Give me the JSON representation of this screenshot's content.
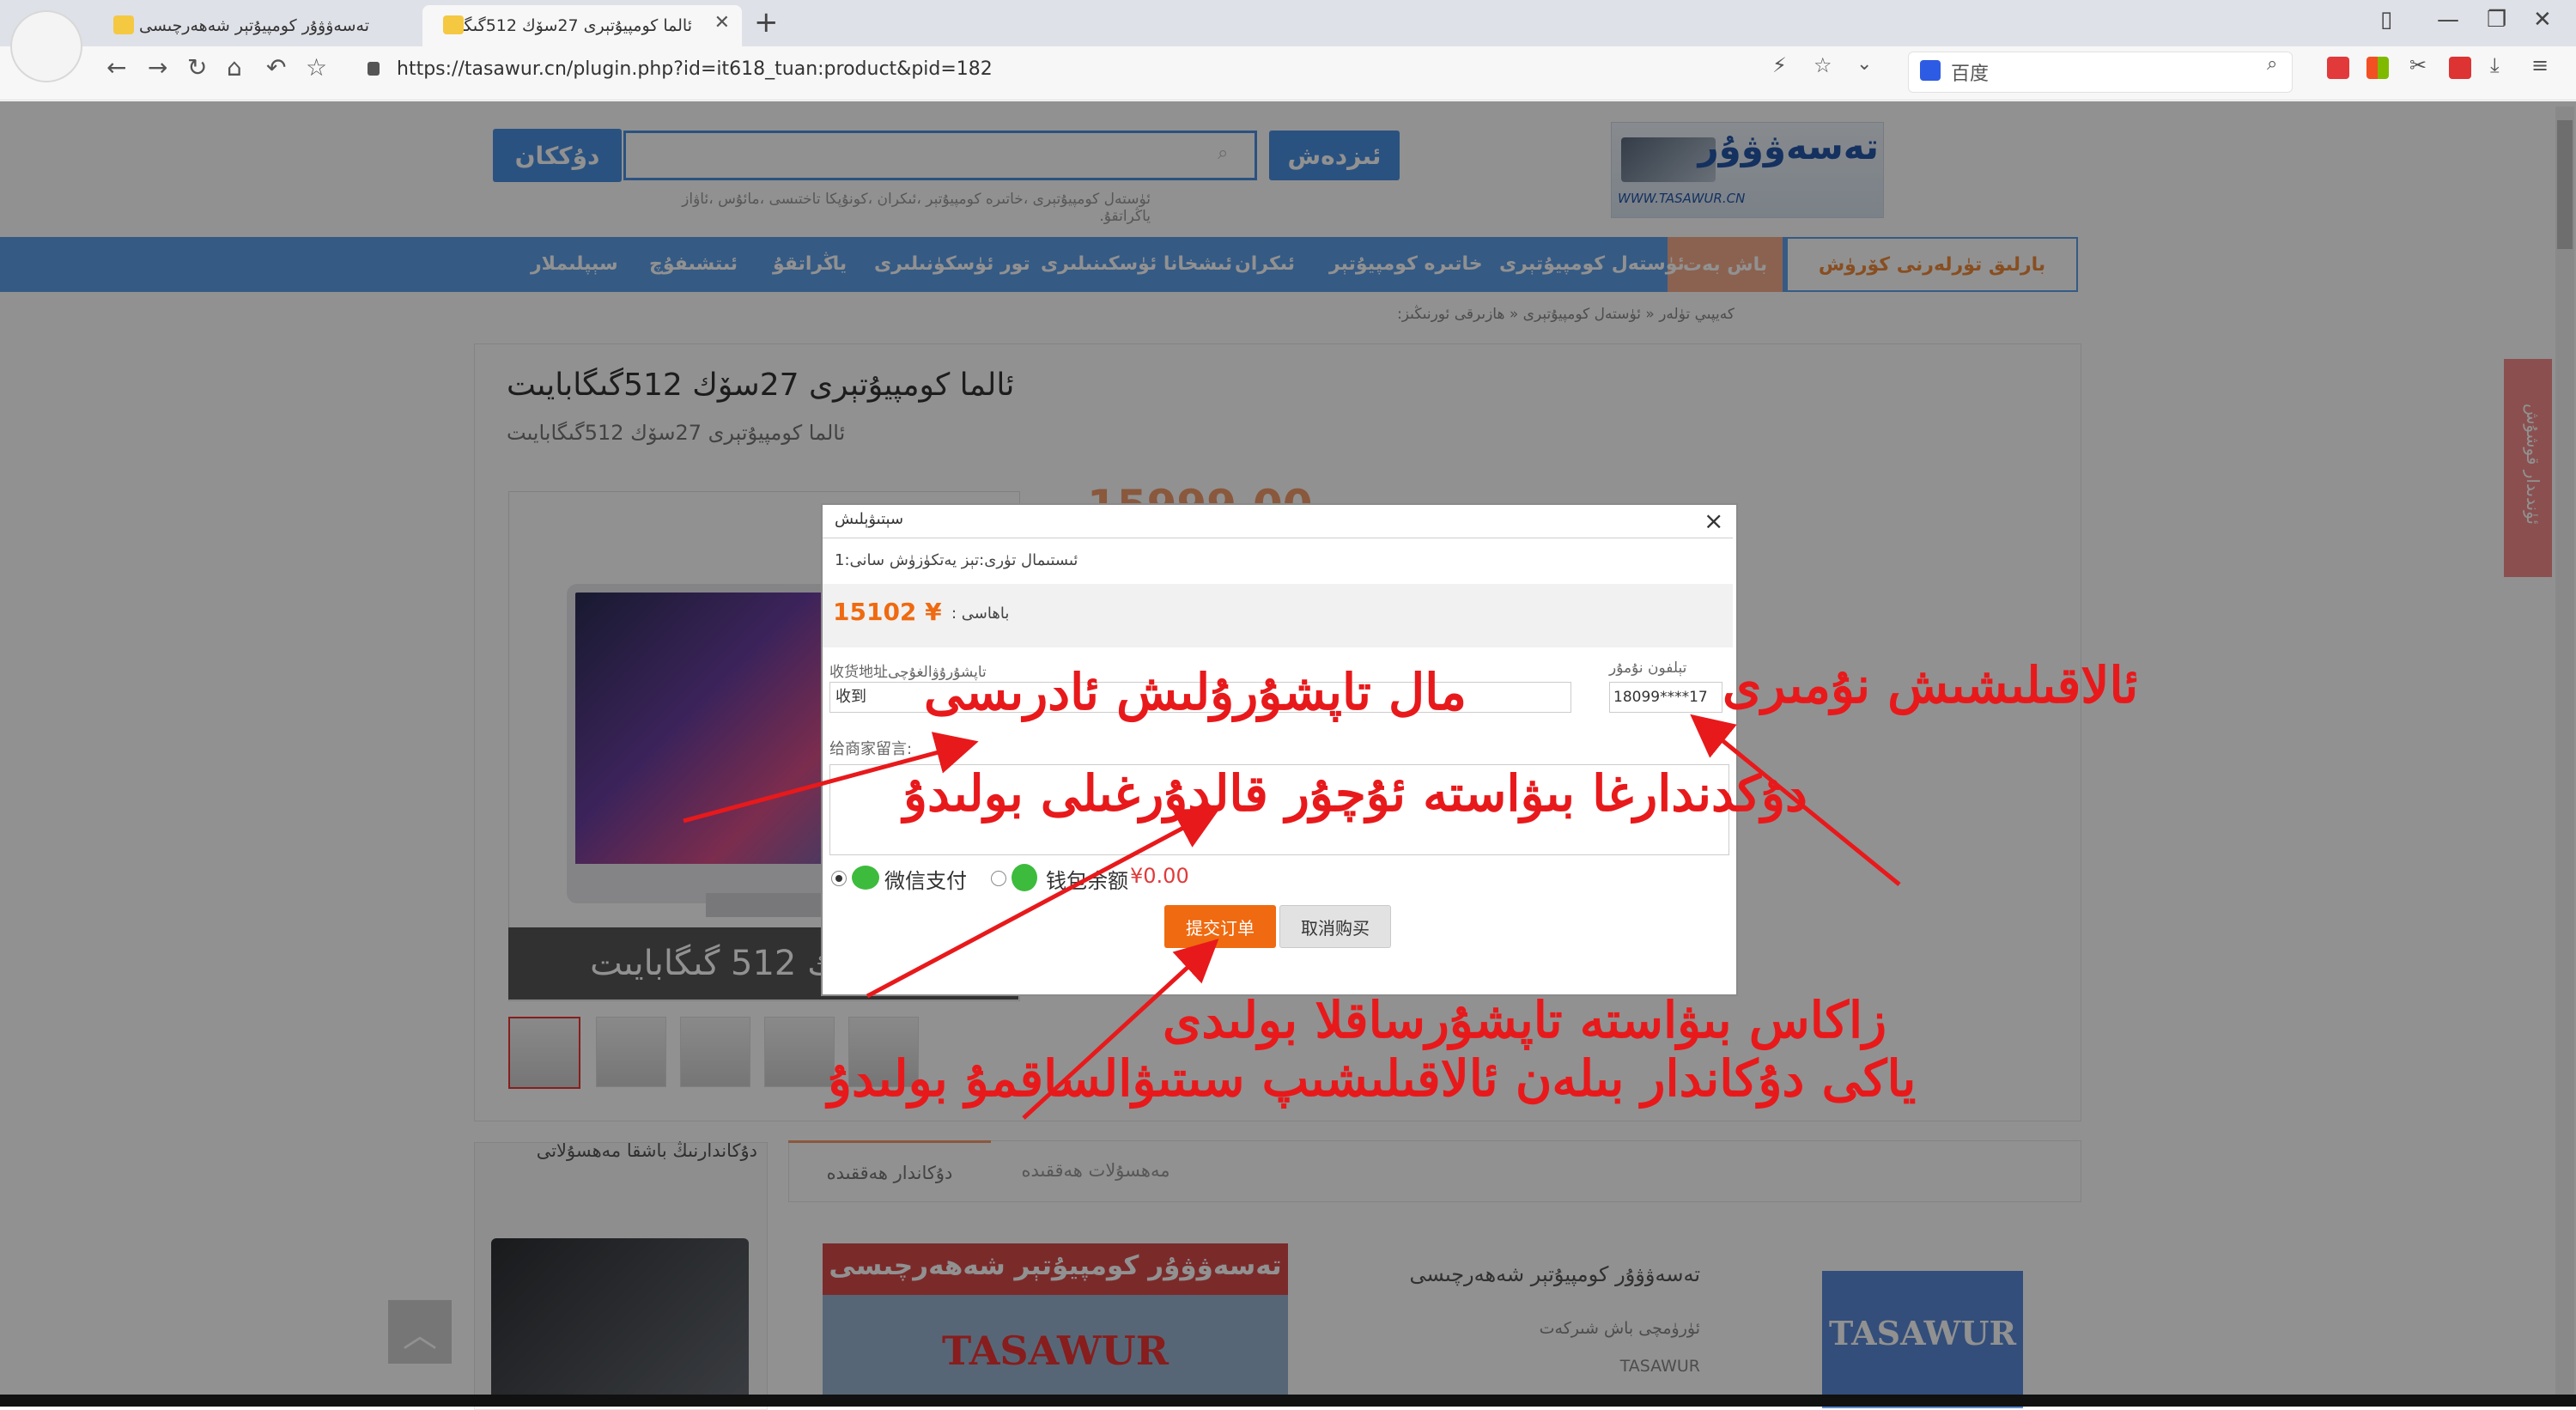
{
  "browser": {
    "tabs": [
      {
        "label": "تەسەۋۋۇر كومپيۇتېر شەھەرچىسى",
        "active": false
      },
      {
        "label": "ئالما كومپيۇتېرى 27سۆك 512گىگا",
        "active": true
      }
    ],
    "url": "https://tasawur.cn/plugin.php?id=it618_tuan:product&pid=182",
    "search_engine": "百度"
  },
  "site": {
    "logo_title": "تەسەۋۋۇر",
    "logo_subtitle": "WWW.TASAWUR.CN",
    "search_button": "ئىزدەش",
    "shop_button": "دۇككان",
    "hot_words": "ئۈستەل كومپيۇتېرى ،خاتىرە كومپيۇتېر ،ئىكران ،كونۇپكا تاختىسى ،مائۇس ،ئاۋاز ياڭراتقۇ.",
    "nav": {
      "categories": "بارلىق تۈرلەرنى كۆرۈش",
      "items": [
        "باش بەت",
        "ئۈستەل كومپيۇتېرى",
        "خاتىرە كومپيۇتېر",
        "ئىكران",
        "ئىشخانا ئۈسكىنىلىرى",
        "تور ئۈسكۈنىلىرى",
        "ياڭراتقۇ",
        "ئىتشىفۇچ",
        "سېپلىملار"
      ]
    },
    "breadcrumb": "كەيپىي تۈلەر « ئۈستەل كومپيۇتېرى « ھازىرقى ئورنىڭىز:"
  },
  "product": {
    "title": "ئالما كومپيۇتېرى 27سۆك 512گىگابايىت",
    "subtitle": "ئالما كومپيۇتېرى 27سۆك 512گىگابايىت",
    "caption": "27 سۆك 512 گىگابايىت",
    "price_bg": "15999.00"
  },
  "lower": {
    "shop_info_title": "دۇكاندارنىڭ باشقا مەھسۇلاتى",
    "tab_shop": "دۇكاندار ھەققىدە",
    "tab_product": "مەھسۇلات ھەققىدە",
    "banner_title": "تەسەۋۋۇر كومپيۇتېر شەھەرچىسى",
    "banner_word": "TASAWUR",
    "shop_name": "تەسەۋۋۇر كومپيۇتېر شەھەرچىسى",
    "shop_company": "ئۈرۈمچى باش شىركەت",
    "shop_boss": "TASAWUR",
    "shop_logo": "TASAWUR",
    "side_service": "ئۈندىدار قوشۇش"
  },
  "modal": {
    "title": "سېتىۋېلىش",
    "close": "×",
    "item_line": "ئىستىمال تۈرى:تېز يەتكۈزۈش سانى:1",
    "price_label": "باھاسى :",
    "price": "15102 ¥",
    "address_label": "تاپشۇرۇۋالغۇچى收货地址",
    "address_value": "收到",
    "phone_label": "تېلفون نۇمۇر",
    "phone_value": "18099****17",
    "message_label": "给商家留言:",
    "pay_wechat": "微信支付",
    "pay_wallet": "钱包余额",
    "wallet_amount": "¥0.00",
    "submit": "提交订单",
    "cancel": "取消购买"
  },
  "annotations": {
    "phone_note": "ئالاقىلىشىش نۇمىرى",
    "address_note": "مال تاپشۇرۇلىش ئادرىسى",
    "message_note": "دۇكدندارغا بىۋاستە ئۇچۇر قالدۇرغىلى بولىدۇ",
    "submit_note_1": "زاكاس بىۋاستە تاپشۇرساقلا بولىدى",
    "submit_note_2": "ياكى دۇكاندار بىلەن ئالاقىلىشىپ سىتىۋالساقمۇ بولىدۇ"
  },
  "colors": {
    "accent": "#4a90e2",
    "nav_bg": "#5e9ee8",
    "annotation": "#e8191b",
    "price": "#ef6a10"
  }
}
